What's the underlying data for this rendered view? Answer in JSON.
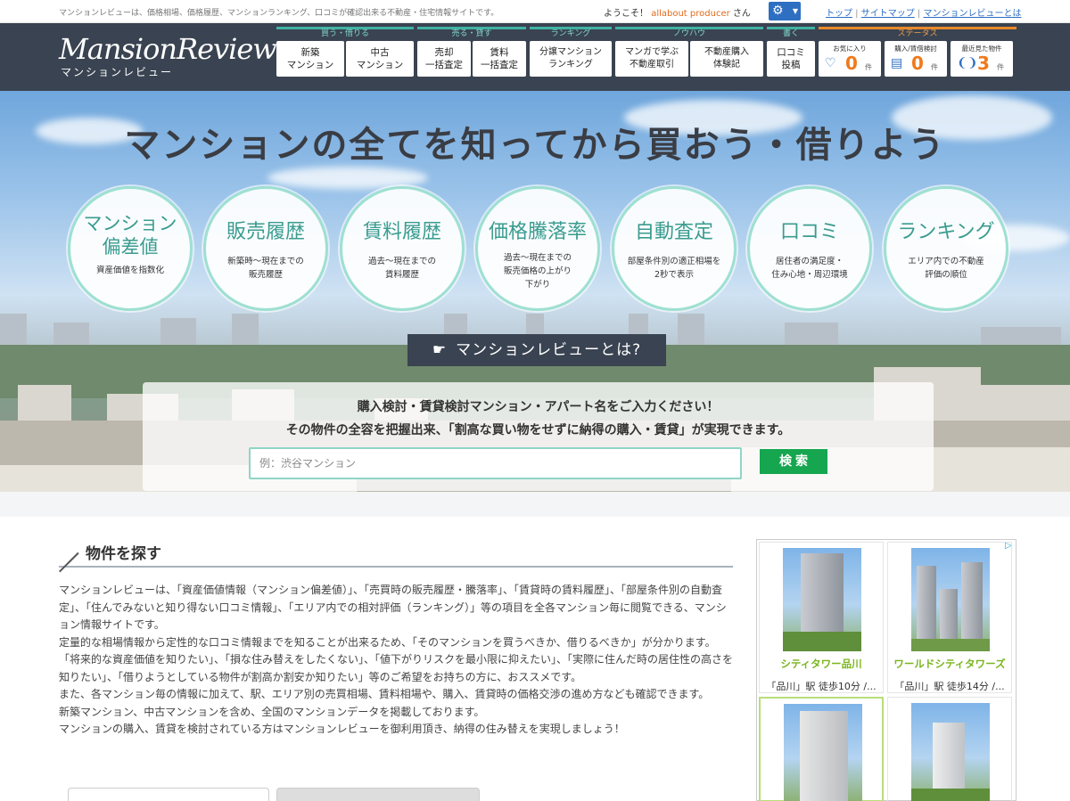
{
  "topbar": {
    "description": "マンションレビューは、価格相場、価格履歴、マンションランキング、口コミが確認出来る不動産・住宅情報サイトです。",
    "welcome_prefix": "ようこそ！",
    "user_name": "allabout producer",
    "welcome_suffix": "さん",
    "settings_icon": "gear-icon",
    "links": [
      "トップ",
      "サイトマップ",
      "マンションレビューとは"
    ]
  },
  "header": {
    "logo_en": "MansionReview",
    "logo_ja": "マンションレビュー",
    "nav_groups": [
      {
        "title": "買う・借りる",
        "buttons": [
          "新築\nマンション",
          "中古\nマンション"
        ]
      },
      {
        "title": "売る・貸す",
        "buttons": [
          "売却\n一括査定",
          "賃料\n一括査定"
        ]
      },
      {
        "title": "ランキング",
        "buttons": [
          "分譲マンション\nランキング"
        ]
      },
      {
        "title": "ノウハウ",
        "buttons": [
          "マンガで学ぶ\n不動産取引",
          "不動産購入\n体験記"
        ]
      },
      {
        "title": "書く",
        "buttons": [
          "口コミ\n投稿"
        ]
      }
    ],
    "status": {
      "title": "ステータス",
      "items": [
        {
          "label": "お気に入り",
          "icon": "heart-icon",
          "count": "0",
          "unit": "件"
        },
        {
          "label": "購入/賃借検討",
          "icon": "list-icon",
          "count": "0",
          "unit": "件"
        },
        {
          "label": "最近見た物件",
          "icon": "footprints-icon",
          "count": "3",
          "unit": "件"
        }
      ]
    }
  },
  "hero": {
    "headline": "マンションの全てを知ってから買おう・借りよう",
    "features": [
      {
        "title": "マンション\n偏差値",
        "sub": "資産価値を指数化"
      },
      {
        "title": "販売履歴",
        "sub": "新築時〜現在までの\n販売履歴"
      },
      {
        "title": "賃料履歴",
        "sub": "過去〜現在までの\n賃料履歴"
      },
      {
        "title": "価格騰落率",
        "sub": "過去〜現在までの\n販売価格の上がり\n下がり"
      },
      {
        "title": "自動査定",
        "sub": "部屋条件別の適正相場を\n2秒で表示"
      },
      {
        "title": "口コミ",
        "sub": "居住者の満足度・\n住み心地・周辺環境"
      },
      {
        "title": "ランキング",
        "sub": "エリア内での不動産\n評価の順位"
      }
    ],
    "about_button": "マンションレビューとは?",
    "search": {
      "line1": "購入検討・賃貸検討マンション・アパート名をご入力ください！",
      "line2": "その物件の全容を把握出来、「割高な買い物をせずに納得の購入・賃貸」が実現できます。",
      "placeholder": "例：渋谷マンション",
      "button": "検索"
    }
  },
  "main": {
    "section_title": "物件を探す",
    "paragraphs": [
      "マンションレビューは、「資産価値情報（マンション偏差値）」、「売買時の販売履歴・騰落率」、「賃貸時の賃料履歴」、「部屋条件別の自動査定」、「住んでみないと知り得ない口コミ情報」、「エリア内での相対評価（ランキング）」等の項目を全各マンション毎に閲覧できる、マンション情報サイトです。",
      "定量的な相場情報から定性的な口コミ情報までを知ることが出来るため、「そのマンションを買うべきか、借りるべきか」が分かります。",
      "「将来的な資産価値を知りたい」、「損な住み替えをしたくない」、「値下がりリスクを最小限に抑えたい」、「実際に住んだ時の居住性の高さを知りたい」、「借りようとしている物件が割高か割安か知りたい」等のご希望をお持ちの方に、おススメです。",
      "また、各マンション毎の情報に加えて、駅、エリア別の売買相場、賃料相場や、購入、賃貸時の価格交渉の進め方なども確認できます。",
      "新築マンション、中古マンションを含め、全国のマンションデータを掲載しております。",
      "マンションの購入、賃貸を検討されている方はマンションレビューを御利用頂き、納得の住み替えを実現しましょう！"
    ]
  },
  "ad": {
    "items": [
      {
        "name": "シティタワー品川",
        "station": "「品川」駅 徒歩10分 /..."
      },
      {
        "name": "ワールドシティタワーズ",
        "station": "「品川」駅 徒歩14分 /..."
      },
      {
        "name": "",
        "station": ""
      },
      {
        "name": "",
        "station": ""
      }
    ]
  }
}
